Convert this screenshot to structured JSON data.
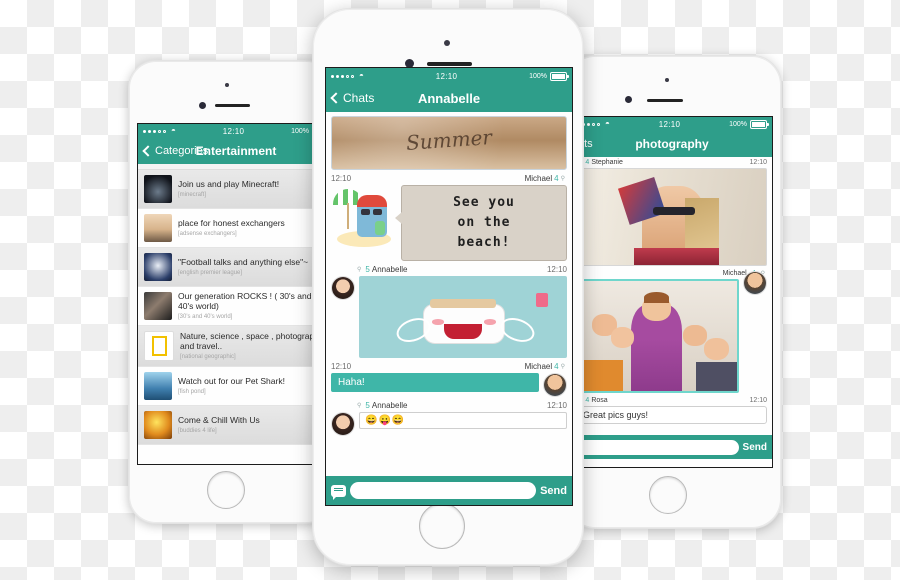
{
  "scene": {
    "description": "Three white iPhones showing a mobile group-chat app",
    "accent_color": "#2e9e8a",
    "bubble_green": "#3fb6a8"
  },
  "status_bar": {
    "signal_dots_filled": 3,
    "signal_dots_empty": 2,
    "wifi_icon": "wifi-icon",
    "time": "12:10",
    "battery_percent": "100%",
    "battery_icon": "battery-full-icon"
  },
  "left_phone": {
    "nav": {
      "back_icon": "chevron-left-icon",
      "back_label": "Categories",
      "title": "Entertainment"
    },
    "list": [
      {
        "title": "Join us and play Minecraft!",
        "subtitle": "[minecraft]",
        "thumb": "minecraft-thumb"
      },
      {
        "title": "place for honest exchangers",
        "subtitle": "[adsense exchangers]",
        "thumb": "exchangers-thumb"
      },
      {
        "title": "\"Football talks and anything else\"~",
        "subtitle": "[english premier league]",
        "thumb": "football-thumb"
      },
      {
        "title": "Our generation ROCKS !  ( 30's and 40's world)",
        "subtitle": "[30's and 40's world]",
        "thumb": "rock-thumb"
      },
      {
        "title": "Nature, science , space , photography and travel..",
        "subtitle": "[national geographic]",
        "thumb": "natgeo-thumb"
      },
      {
        "title": "Watch out for our Pet Shark!",
        "subtitle": "[fish pond]",
        "thumb": "shark-thumb"
      },
      {
        "title": "Come & Chill With Us",
        "subtitle": "[buddies 4 life]",
        "thumb": "chill-thumb"
      }
    ]
  },
  "center_phone": {
    "nav": {
      "back_icon": "chevron-left-icon",
      "back_label": "Chats",
      "title": "Annabelle"
    },
    "messages": [
      {
        "type": "image",
        "sender": "",
        "image_name": "summer-sand-photo",
        "image_caption": "Summer"
      },
      {
        "type": "sticker_text",
        "time": "12:10",
        "sender": "Michael",
        "badge": "4",
        "pin_icon": "pin-icon",
        "sticker_name": "beach-umbrella-sticker",
        "text": "See  you\non  the\nbeach!"
      },
      {
        "type": "image",
        "sender": "Annabelle",
        "badge": "5",
        "pin_icon": "pin-icon",
        "time": "12:10",
        "avatar_name": "annabelle-avatar",
        "image_name": "toaster-sticker"
      },
      {
        "type": "text",
        "time": "12:10",
        "sender": "Michael",
        "badge": "4",
        "pin_icon": "pin-icon",
        "avatar_name": "michael-avatar",
        "text": "Haha!"
      },
      {
        "type": "emoji",
        "sender": "Annabelle",
        "badge": "5",
        "pin_icon": "pin-icon",
        "time": "12:10",
        "avatar_name": "annabelle-avatar",
        "text": "😄😛😄"
      }
    ],
    "composer": {
      "chat_icon": "chat-bubble-icon",
      "input_value": "",
      "input_placeholder": "",
      "send_label": "Send"
    }
  },
  "right_phone": {
    "nav": {
      "back_icon": "chevron-left-icon",
      "back_label": "ats",
      "title": "photography"
    },
    "messages": [
      {
        "sender": "Stephanie",
        "badge": "4",
        "pin_icon": "pin-icon",
        "time": "12:10",
        "image_name": "girl-glasses-photo"
      },
      {
        "sender": "Michael",
        "badge": "4",
        "pin_icon": "pin-icon",
        "avatar_name": "michael-avatar",
        "image_name": "group-selfie-photo"
      },
      {
        "sender": "Rosa",
        "badge": "4",
        "pin_icon": "pin-icon",
        "time": "12:10",
        "text": "Great pics guys!"
      }
    ],
    "composer": {
      "input_value": "",
      "send_label": "Send"
    }
  }
}
